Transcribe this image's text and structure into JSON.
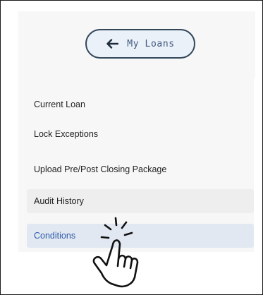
{
  "sidebar": {
    "back_button": {
      "label": "My Loans",
      "icon": "arrow-left-icon"
    },
    "items": [
      {
        "label": "Current Loan",
        "state": "default"
      },
      {
        "label": "Lock Exceptions",
        "state": "default"
      },
      {
        "label": "Upload Pre/Post Closing Package",
        "state": "default"
      },
      {
        "label": "Audit History",
        "state": "hover"
      },
      {
        "label": "Conditions",
        "state": "active"
      }
    ]
  },
  "cursor": {
    "icon": "pointing-hand-click-icon"
  },
  "colors": {
    "accent": "#2a5aa8",
    "button_border": "#33475b",
    "button_fill": "#ebf1f8",
    "active_row": "#e2e8f2",
    "hover_row": "#eeeeee"
  }
}
